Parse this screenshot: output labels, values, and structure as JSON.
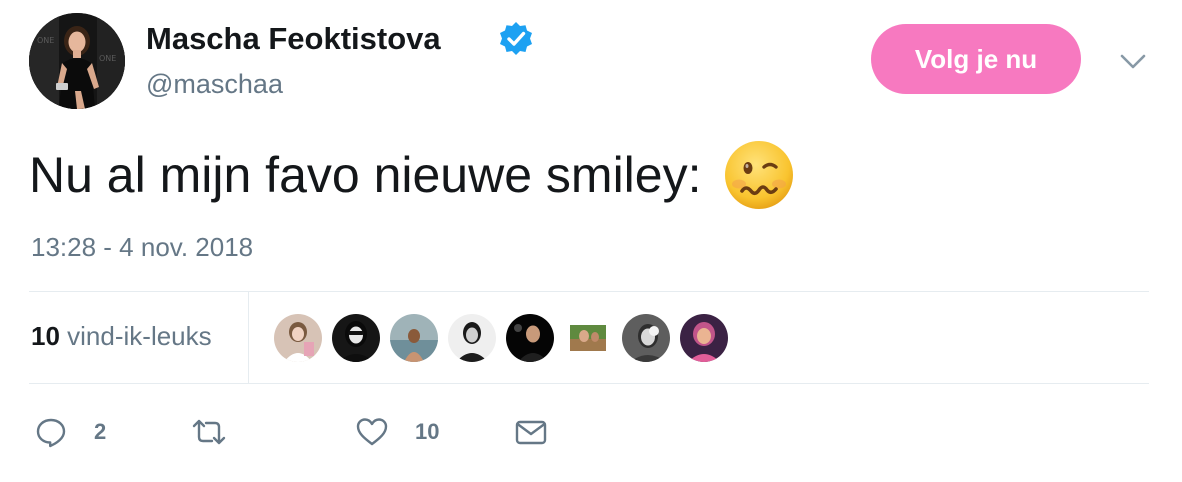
{
  "user": {
    "display_name": "Mascha Feoktistova",
    "handle": "@maschaa",
    "verified": true
  },
  "follow_button": {
    "label": "Volg je nu",
    "color": "#f779c0"
  },
  "tweet": {
    "text": "Nu al mijn favo nieuwe smiley:",
    "emoji": "woozy-face",
    "timestamp": "13:28 - 4 nov. 2018"
  },
  "stats": {
    "likes_count": "10",
    "likes_label": "vind-ik-leuks"
  },
  "likers": [
    {
      "name": "liker-avatar-1",
      "colors": [
        "#c9a68f",
        "#f2d8cc"
      ]
    },
    {
      "name": "liker-avatar-2",
      "colors": [
        "#1e1e1e",
        "#e4e4e4"
      ]
    },
    {
      "name": "liker-avatar-3",
      "colors": [
        "#8aa0a8",
        "#b28a6a"
      ]
    },
    {
      "name": "liker-avatar-4",
      "colors": [
        "#e9e9e9",
        "#2a2a2a"
      ]
    },
    {
      "name": "liker-avatar-5",
      "colors": [
        "#111111",
        "#c89a7a"
      ]
    },
    {
      "name": "liker-avatar-6",
      "colors": [
        "#4e7a3a",
        "#d2a07e"
      ]
    },
    {
      "name": "liker-avatar-7",
      "colors": [
        "#6b6b6b",
        "#dcdcdc"
      ]
    },
    {
      "name": "liker-avatar-8",
      "colors": [
        "#4a2a5e",
        "#e6b08e"
      ]
    }
  ],
  "actions": {
    "reply_count": "2",
    "like_count": "10"
  },
  "colors": {
    "text_primary": "#14171a",
    "text_secondary": "#657786",
    "verified_blue": "#1da1f2",
    "divider": "#e6ecf0"
  }
}
